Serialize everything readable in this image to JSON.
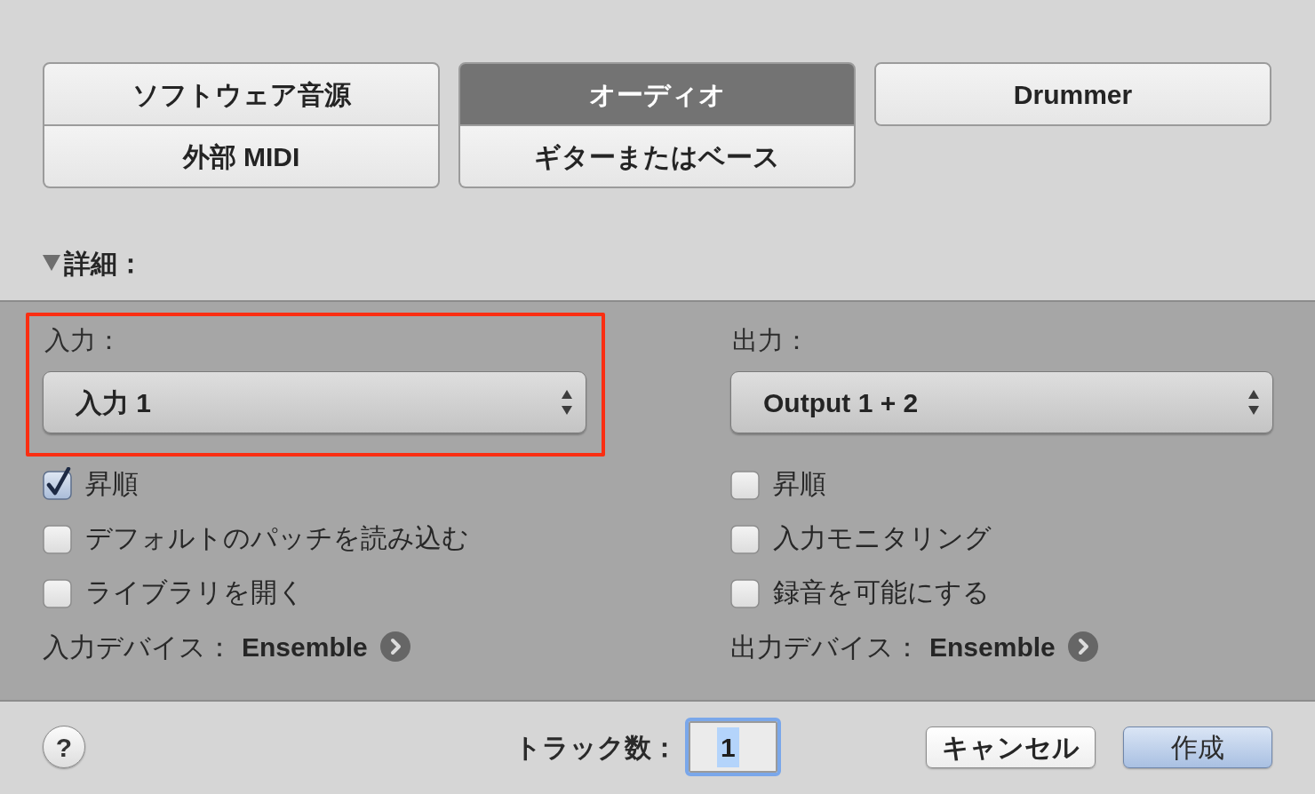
{
  "track_type_groups": [
    {
      "options": [
        {
          "label": "ソフトウェア音源",
          "selected": false
        },
        {
          "label": "外部 MIDI",
          "selected": false
        }
      ]
    },
    {
      "options": [
        {
          "label": "オーディオ",
          "selected": true
        },
        {
          "label": "ギターまたはベース",
          "selected": false
        }
      ]
    },
    {
      "options": [
        {
          "label": "Drummer",
          "selected": false
        }
      ]
    }
  ],
  "details": {
    "label": "詳細：",
    "expanded": true
  },
  "io_columns": [
    {
      "label": "入力：",
      "value": "入力 1",
      "highlighted": true,
      "options": [
        {
          "label": "昇順",
          "checked": true
        },
        {
          "label": "デフォルトのパッチを読み込む",
          "checked": false
        },
        {
          "label": "ライブラリを開く",
          "checked": false
        }
      ],
      "device_label": "入力デバイス：",
      "device": "Ensemble"
    },
    {
      "label": "出力：",
      "value": "Output 1 + 2",
      "highlighted": false,
      "options": [
        {
          "label": "昇順",
          "checked": false
        },
        {
          "label": "入力モニタリング",
          "checked": false
        },
        {
          "label": "録音を可能にする",
          "checked": false
        }
      ],
      "device_label": "出力デバイス：",
      "device": "Ensemble"
    }
  ],
  "footer": {
    "help": "?",
    "track_count_label": "トラック数：",
    "track_count": {
      "value": "1",
      "text_selected": true
    },
    "buttons": [
      {
        "label": "キャンセル",
        "kind": "cancel"
      },
      {
        "label": "作成",
        "kind": "default"
      }
    ]
  }
}
